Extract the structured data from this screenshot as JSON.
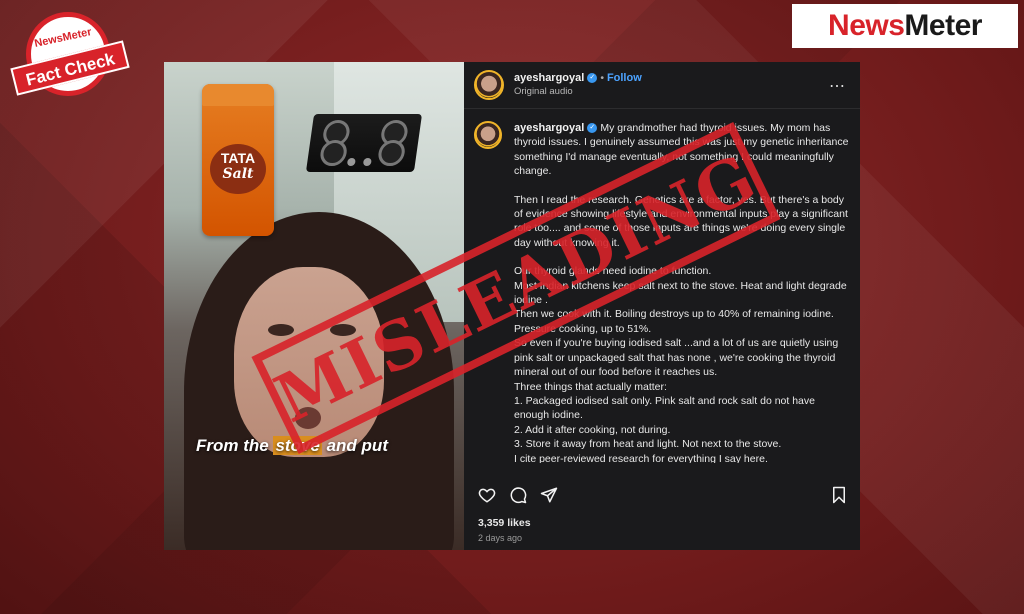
{
  "brand": {
    "logo_news": "News",
    "logo_meter": "Meter",
    "badge_brand": "NewsMeter",
    "badge_label": "Fact Check"
  },
  "stamp": {
    "text": "MISLEADING"
  },
  "video": {
    "caption_pre": "From the ",
    "caption_highlight": "stove",
    "caption_post": " and put",
    "jar_brand": "TATA",
    "jar_product": "Salt"
  },
  "post": {
    "username": "ayeshargoyal",
    "follow_label": "Follow",
    "audio_label": "Original audio",
    "more_icon": "⋯",
    "caption_paragraphs": [
      "My grandmother had thyroid issues. My mom has thyroid issues. I genuinely assumed this was just my genetic inheritance something I'd manage eventually, not something I could meaningfully change.",
      "Then I read the research. Genetics are a factor, yes. But there's a body of evidence showing lifestyle and environmental inputs play a significant role too.... and some of those inputs are things we're doing every single day without knowing it.",
      "Our thyroid glands need iodine to function.\nMost Indian kitchens keep salt next to the stove. Heat and light degrade iodine .\nThen we cook with it. Boiling destroys up to 40% of remaining iodine. Pressure cooking, up to 51%.\nSo even if you're buying iodised salt ...and a lot of us are quietly using pink salt or unpackaged salt that has none , we're cooking the thyroid mineral out of our food before it reaches us.\nThree things that actually matter:\n1. Packaged iodised salt only. Pink salt and rock salt do not have enough iodine.\n2. Add it after cooking, not during.\n3. Store it away from heat and light. Not next to the stove.\nI cite peer-reviewed research for everything I say here."
    ],
    "likes": "3,359 likes",
    "time_ago": "2 days ago"
  }
}
